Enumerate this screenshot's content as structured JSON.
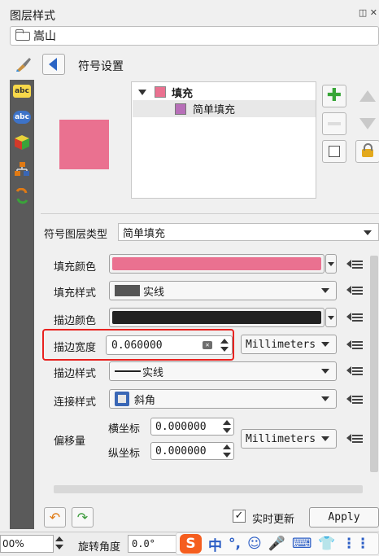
{
  "panel": {
    "title": "图层样式",
    "title_icons": "◫ ✕"
  },
  "layer_selector": {
    "value": "嵩山"
  },
  "header": {
    "section": "符号设置"
  },
  "left_toolbar": {
    "items": [
      "abc",
      "abc"
    ]
  },
  "symbol_tree": {
    "root_label": "填充",
    "child_label": "简单填充"
  },
  "symbol_layer": {
    "type_label": "符号图层类型",
    "type_value": "简单填充"
  },
  "properties": {
    "fill_color_label": "填充颜色",
    "fill_color": "#ea7190",
    "fill_style_label": "填充样式",
    "fill_style_value": "实线",
    "stroke_color_label": "描边颜色",
    "stroke_color": "#222222",
    "stroke_width_label": "描边宽度",
    "stroke_width_value": "0.060000",
    "stroke_width_unit": "Millimeters",
    "stroke_style_label": "描边样式",
    "stroke_style_value": "实线",
    "join_style_label": "连接样式",
    "join_style_value": "斜角",
    "offset_label": "偏移量",
    "offset_x_label": "横坐标",
    "offset_x_value": "0.000000",
    "offset_y_label": "纵坐标",
    "offset_y_value": "0.000000",
    "offset_unit": "Millimeters"
  },
  "footer": {
    "live_update_label": "实时更新",
    "live_update_checked": "✓",
    "apply_label": "Apply"
  },
  "statusbar": {
    "zoom_value": "00%",
    "rotation_label": "旋转角度",
    "rotation_value": "0.0°",
    "ime_items": [
      "中",
      "°,",
      "☺",
      "🎤",
      "⌨",
      "👕",
      "⋮⋮"
    ]
  },
  "colors": {
    "accent_red_highlight": "#e8221f",
    "fill_pink": "#ea7190",
    "tree_child_purple": "#b76fb8"
  }
}
